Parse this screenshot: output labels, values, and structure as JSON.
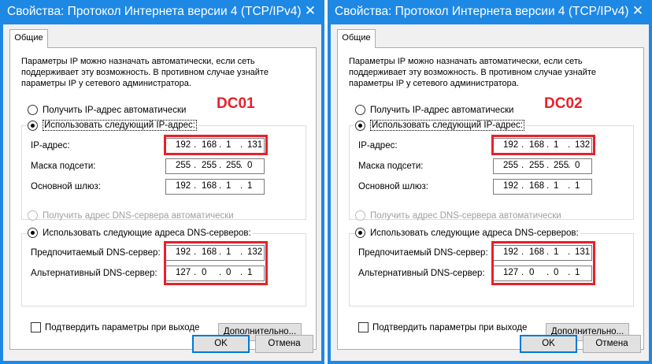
{
  "windows": [
    {
      "title": "Свойства: Протокол Интернета версии 4 (TCP/IPv4)",
      "close_glyph": "✕",
      "tab_label": "Общие",
      "description": "Параметры IP можно назначать автоматически, если сеть поддерживает эту возможность. В противном случае узнайте параметры IP у сетевого администратора.",
      "annotation": "DC01",
      "ip_auto_label": "Получить IP-адрес автоматически",
      "ip_manual_label": "Использовать следующий IP-адрес:",
      "ip_label": "IP-адрес:",
      "ip": [
        "192",
        "168",
        "1",
        "131"
      ],
      "mask_label": "Маска подсети:",
      "mask": [
        "255",
        "255",
        "255",
        "0"
      ],
      "gateway_label": "Основной шлюз:",
      "gateway": [
        "192",
        "168",
        "1",
        "1"
      ],
      "dns_auto_label": "Получить адрес DNS-сервера автоматически",
      "dns_manual_label": "Использовать следующие адреса DNS-серверов:",
      "preferred_dns_label": "Предпочитаемый DNS-сервер:",
      "preferred_dns": [
        "192",
        "168",
        "1",
        "132"
      ],
      "alternate_dns_label": "Альтернативный DNS-сервер:",
      "alternate_dns": [
        "127",
        "0",
        "0",
        "1"
      ],
      "confirm_label": "Подтвердить параметры при выходе",
      "advanced_label": "Дополнительно...",
      "ok_label": "OK",
      "cancel_label": "Отмена"
    },
    {
      "title": "Свойства: Протокол Интернета версии 4 (TCP/IPv4)",
      "close_glyph": "✕",
      "tab_label": "Общие",
      "description": "Параметры IP можно назначать автоматически, если сеть поддерживает эту возможность. В противном случае узнайте параметры IP у сетевого администратора.",
      "annotation": "DC02",
      "ip_auto_label": "Получить IP-адрес автоматически",
      "ip_manual_label": "Использовать следующий IP-адрес:",
      "ip_label": "IP-адрес:",
      "ip": [
        "192",
        "168",
        "1",
        "132"
      ],
      "mask_label": "Маска подсети:",
      "mask": [
        "255",
        "255",
        "255",
        "0"
      ],
      "gateway_label": "Основной шлюз:",
      "gateway": [
        "192",
        "168",
        "1",
        "1"
      ],
      "dns_auto_label": "Получить адрес DNS-сервера автоматически",
      "dns_manual_label": "Использовать следующие адреса DNS-серверов:",
      "preferred_dns_label": "Предпочитаемый DNS-сервер:",
      "preferred_dns": [
        "192",
        "168",
        "1",
        "131"
      ],
      "alternate_dns_label": "Альтернативный DNS-сервер:",
      "alternate_dns": [
        "127",
        "0",
        "0",
        "1"
      ],
      "confirm_label": "Подтвердить параметры при выходе",
      "advanced_label": "Дополнительно...",
      "ok_label": "OK",
      "cancel_label": "Отмена"
    }
  ],
  "colors": {
    "title_bar": "#1e88e5",
    "highlight": "#e8202a",
    "dialog_bg": "#f0f0f0"
  },
  "icons": {
    "close": "close-icon"
  }
}
